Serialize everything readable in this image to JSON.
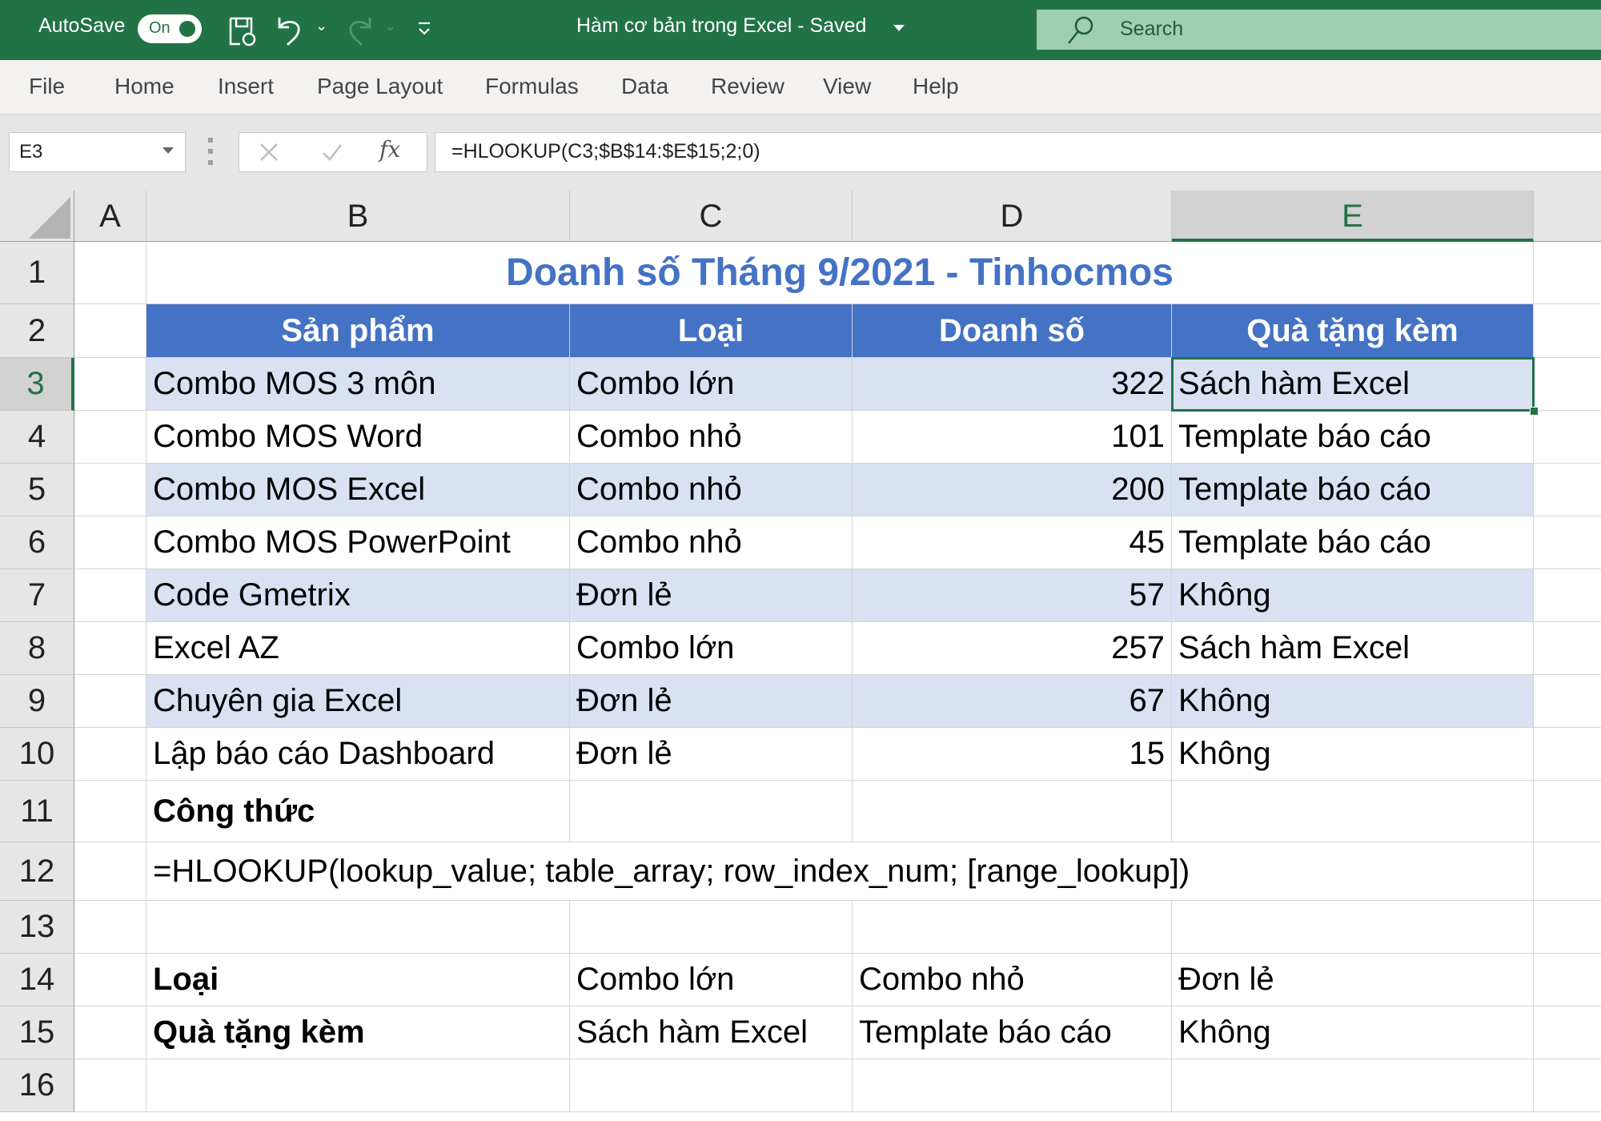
{
  "titlebar": {
    "autosave_label": "AutoSave",
    "autosave_state": "On",
    "document_title": "Hàm cơ bản trong Excel  -  Saved",
    "search_placeholder": "Search"
  },
  "ribbon": {
    "tabs": [
      "File",
      "Home",
      "Insert",
      "Page Layout",
      "Formulas",
      "Data",
      "Review",
      "View",
      "Help"
    ]
  },
  "formula_bar": {
    "name_box": "E3",
    "formula": "=HLOOKUP(C3;$B$14:$E$15;2;0)",
    "fx_label": "fx"
  },
  "sheet": {
    "column_headers": [
      "A",
      "B",
      "C",
      "D",
      "E"
    ],
    "selected_column": "E",
    "selected_row": "3",
    "row_headers": [
      "1",
      "2",
      "3",
      "4",
      "5",
      "6",
      "7",
      "8",
      "9",
      "10",
      "11",
      "12",
      "13",
      "14",
      "15",
      "16"
    ],
    "title": "Doanh số Tháng 9/2021 - Tinhocmos",
    "table_headers": [
      "Sản phẩm",
      "Loại",
      "Doanh số",
      "Quà tặng kèm"
    ],
    "rows": [
      {
        "product": "Combo MOS 3 môn",
        "type": "Combo lớn",
        "sales": "322",
        "gift": "Sách hàm Excel"
      },
      {
        "product": "Combo MOS Word",
        "type": "Combo nhỏ",
        "sales": "101",
        "gift": "Template báo cáo"
      },
      {
        "product": "Combo MOS Excel",
        "type": "Combo nhỏ",
        "sales": "200",
        "gift": "Template báo cáo"
      },
      {
        "product": "Combo MOS PowerPoint",
        "type": "Combo nhỏ",
        "sales": "45",
        "gift": "Template báo cáo"
      },
      {
        "product": "Code Gmetrix",
        "type": "Đơn lẻ",
        "sales": "57",
        "gift": "Không"
      },
      {
        "product": "Excel AZ",
        "type": "Combo lớn",
        "sales": "257",
        "gift": "Sách hàm Excel"
      },
      {
        "product": "Chuyên gia Excel",
        "type": "Đơn lẻ",
        "sales": "67",
        "gift": "Không"
      },
      {
        "product": "Lập báo cáo Dashboard",
        "type": "Đơn lẻ",
        "sales": "15",
        "gift": "Không"
      }
    ],
    "formula_label": "Công thức",
    "formula_syntax": "=HLOOKUP(lookup_value; table_array; row_index_num; [range_lookup])",
    "lookup_table": {
      "row14": {
        "label": "Loại",
        "values": [
          "Combo lớn",
          "Combo nhỏ",
          "Đơn lẻ"
        ]
      },
      "row15": {
        "label": "Quà tặng kèm",
        "values": [
          "Sách hàm Excel",
          "Template báo cáo",
          "Không"
        ]
      }
    }
  },
  "colors": {
    "brand_green": "#217346",
    "header_fill": "#4472c4",
    "band_fill": "#d9e1f2",
    "title_text": "#4472c4"
  }
}
